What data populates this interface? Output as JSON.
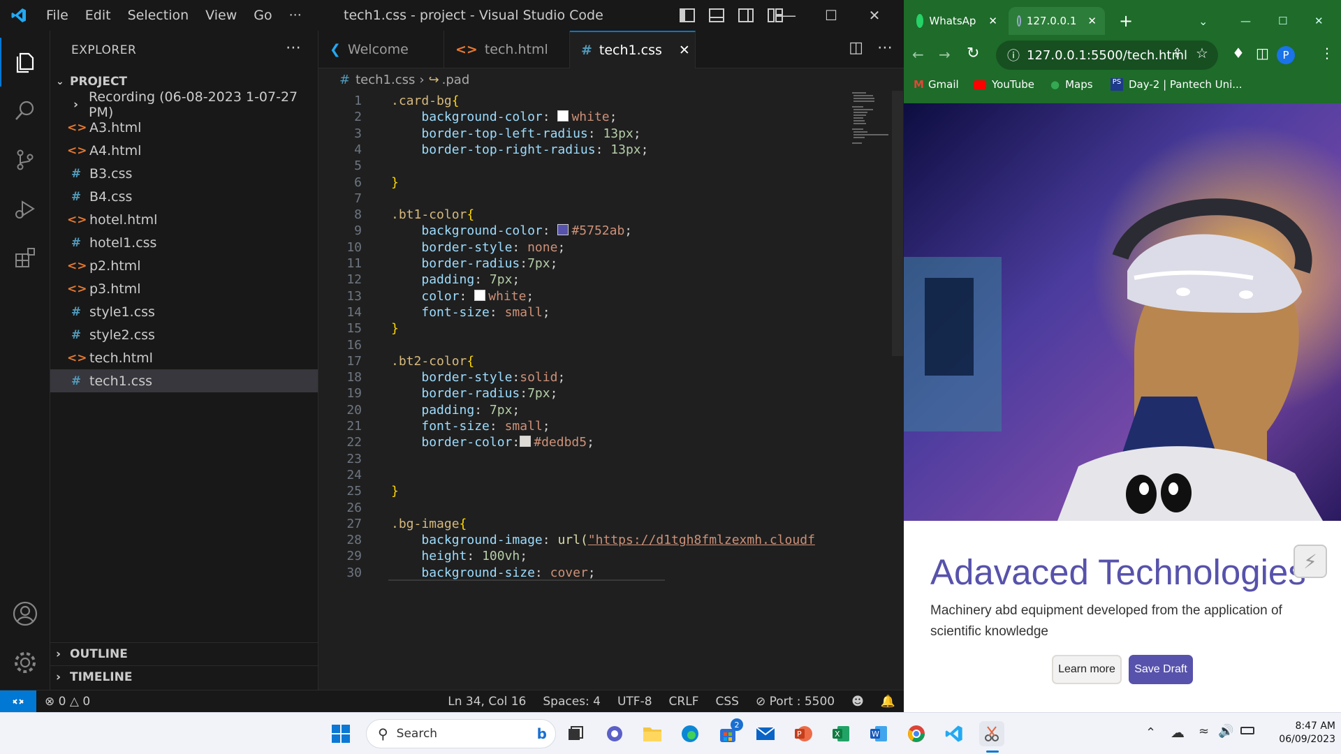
{
  "vscode": {
    "menu": [
      "File",
      "Edit",
      "Selection",
      "View",
      "Go",
      "···"
    ],
    "window_title": "tech1.css - project - Visual Studio Code",
    "explorer": {
      "title": "EXPLORER",
      "project": "PROJECT",
      "files": [
        {
          "name": "Recording (06-08-2023 1-07-27 PM)",
          "type": "folder"
        },
        {
          "name": "A3.html",
          "type": "html"
        },
        {
          "name": "A4.html",
          "type": "html"
        },
        {
          "name": "B3.css",
          "type": "css"
        },
        {
          "name": "B4.css",
          "type": "css"
        },
        {
          "name": "hotel.html",
          "type": "html"
        },
        {
          "name": "hotel1.css",
          "type": "css"
        },
        {
          "name": "p2.html",
          "type": "html"
        },
        {
          "name": "p3.html",
          "type": "html"
        },
        {
          "name": "style1.css",
          "type": "css"
        },
        {
          "name": "style2.css",
          "type": "css"
        },
        {
          "name": "tech.html",
          "type": "html"
        },
        {
          "name": "tech1.css",
          "type": "css",
          "selected": true
        }
      ],
      "outline": "OUTLINE",
      "timeline": "TIMELINE"
    },
    "tabs": [
      {
        "label": "Welcome",
        "icon": "vscode-icon"
      },
      {
        "label": "tech.html",
        "icon": "html-icon"
      },
      {
        "label": "tech1.css",
        "icon": "css-icon",
        "active": true
      }
    ],
    "breadcrumb": {
      "file": "tech1.css",
      "symbol": ".pad"
    },
    "status": {
      "errors": "0",
      "warnings": "0",
      "position": "Ln 34, Col 16",
      "spaces": "Spaces: 4",
      "encoding": "UTF-8",
      "eol": "CRLF",
      "language": "CSS",
      "port": "Port : 5500"
    },
    "colors": {
      "accent": "#0078d4",
      "swatch_purple": "#5752ab",
      "swatch_gray": "#dedbd5"
    }
  },
  "code_lines": [
    {
      "n": "1",
      "t": ".card-bg{"
    },
    {
      "n": "2",
      "t": "    background-color: ■white;"
    },
    {
      "n": "3",
      "t": "    border-top-left-radius: 13px;"
    },
    {
      "n": "4",
      "t": "    border-top-right-radius: 13px;"
    },
    {
      "n": "5",
      "t": ""
    },
    {
      "n": "6",
      "t": "}"
    },
    {
      "n": "7",
      "t": ""
    },
    {
      "n": "8",
      "t": ".bt1-color{"
    },
    {
      "n": "9",
      "t": "    background-color: ■#5752ab;"
    },
    {
      "n": "10",
      "t": "    border-style: none;"
    },
    {
      "n": "11",
      "t": "    border-radius:7px;"
    },
    {
      "n": "12",
      "t": "    padding: 7px;"
    },
    {
      "n": "13",
      "t": "    color: ■white;"
    },
    {
      "n": "14",
      "t": "    font-size: small;"
    },
    {
      "n": "15",
      "t": "}"
    },
    {
      "n": "16",
      "t": ""
    },
    {
      "n": "17",
      "t": ".bt2-color{"
    },
    {
      "n": "18",
      "t": "    border-style:solid;"
    },
    {
      "n": "19",
      "t": "    border-radius:7px;"
    },
    {
      "n": "20",
      "t": "    padding: 7px;"
    },
    {
      "n": "21",
      "t": "    font-size: small;"
    },
    {
      "n": "22",
      "t": "    border-color:■#dedbd5 ;"
    },
    {
      "n": "23",
      "t": ""
    },
    {
      "n": "24",
      "t": ""
    },
    {
      "n": "25",
      "t": "}"
    },
    {
      "n": "26",
      "t": ""
    },
    {
      "n": "27",
      "t": ".bg-image{"
    },
    {
      "n": "28",
      "t": "    background-image: url(\"https://d1tgh8fmlzexmh.cloudf"
    },
    {
      "n": "29",
      "t": "    height: 100vh;"
    },
    {
      "n": "30",
      "t": "    background-size: cover;"
    }
  ],
  "chrome": {
    "tabs": [
      {
        "label": "WhatsAp"
      },
      {
        "label": "127.0.0.1",
        "active": true
      }
    ],
    "url": "127.0.0.1:5500/tech.html",
    "profile": "P",
    "bookmarks": [
      "Gmail",
      "YouTube",
      "Maps",
      "Day-2 | Pantech Uni..."
    ],
    "page": {
      "title": "Adavaced Technologies",
      "text": "Machinery abd equipment developed from the application of scientific knowledge",
      "btn_learn": "Learn more",
      "btn_save": "Save Draft"
    }
  },
  "taskbar": {
    "search": "Search",
    "badge": "2",
    "time": "8:47 AM",
    "date": "06/09/2023"
  }
}
